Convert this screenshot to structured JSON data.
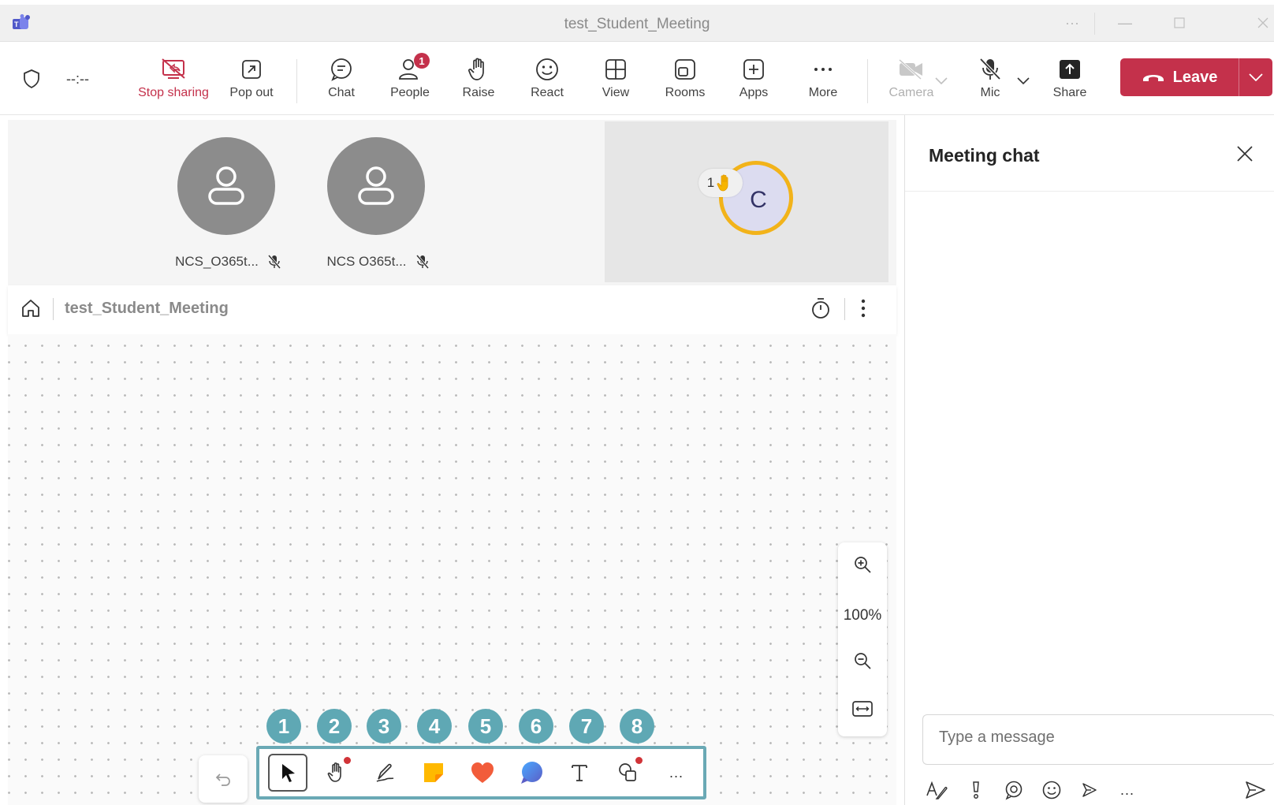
{
  "window": {
    "title": "test_Student_Meeting"
  },
  "toolbar": {
    "timer": "--:--",
    "buttons": {
      "stop_sharing": "Stop sharing",
      "pop_out": "Pop out",
      "chat": "Chat",
      "people": "People",
      "people_badge": "1",
      "raise": "Raise",
      "react": "React",
      "view": "View",
      "rooms": "Rooms",
      "apps": "Apps",
      "more": "More",
      "camera": "Camera",
      "mic": "Mic",
      "share": "Share",
      "leave": "Leave"
    },
    "colors": {
      "leave_bg": "#c4314b",
      "stop_sharing": "#c4314b",
      "active_underline": "#5b5fc7"
    }
  },
  "participants": [
    {
      "name": "NCS_O365t...",
      "muted": true
    },
    {
      "name": "NCS O365t...",
      "muted": true
    }
  ],
  "self_tile": {
    "initial": "C",
    "raised_hand_count": "1"
  },
  "whiteboard": {
    "title": "test_Student_Meeting",
    "zoom": "100%",
    "tools": [
      {
        "number": "1",
        "name": "select"
      },
      {
        "number": "2",
        "name": "pan-hand"
      },
      {
        "number": "3",
        "name": "pen"
      },
      {
        "number": "4",
        "name": "sticky-note"
      },
      {
        "number": "5",
        "name": "reaction-heart"
      },
      {
        "number": "6",
        "name": "comment"
      },
      {
        "number": "7",
        "name": "text"
      },
      {
        "number": "8",
        "name": "shapes"
      }
    ],
    "more": "..."
  },
  "chat": {
    "title": "Meeting chat",
    "placeholder": "Type a message",
    "more": "..."
  }
}
